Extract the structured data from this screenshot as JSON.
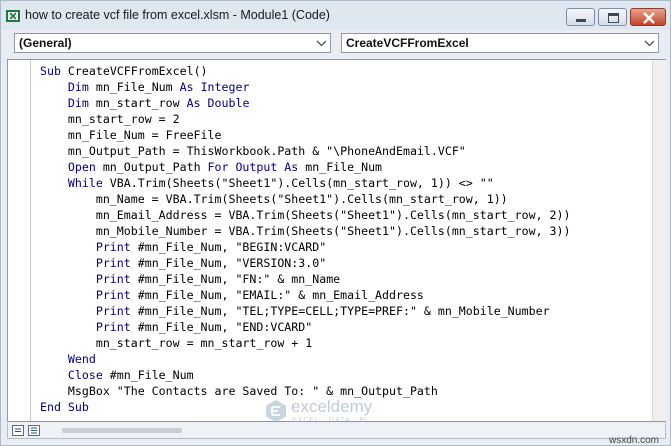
{
  "window": {
    "title": "how to create vcf file from excel.xlsm - Module1 (Code)"
  },
  "toolbar": {
    "object_dropdown": "(General)",
    "procedure_dropdown": "CreateVCFFromExcel"
  },
  "code_lines": [
    {
      "indent": 0,
      "parts": [
        {
          "t": "Sub",
          "k": true
        },
        {
          "t": " CreateVCFFromExcel()"
        }
      ]
    },
    {
      "indent": 1,
      "parts": [
        {
          "t": "Dim",
          "k": true
        },
        {
          "t": " mn_File_Num "
        },
        {
          "t": "As Integer",
          "k": true
        }
      ]
    },
    {
      "indent": 1,
      "parts": [
        {
          "t": "Dim",
          "k": true
        },
        {
          "t": " mn_start_row "
        },
        {
          "t": "As Double",
          "k": true
        }
      ]
    },
    {
      "indent": 1,
      "parts": [
        {
          "t": "mn_start_row = 2"
        }
      ]
    },
    {
      "indent": 1,
      "parts": [
        {
          "t": "mn_File_Num = FreeFile"
        }
      ]
    },
    {
      "indent": 1,
      "parts": [
        {
          "t": "mn_Output_Path = ThisWorkbook.Path & \"\\PhoneAndEmail.VCF\""
        }
      ]
    },
    {
      "indent": 1,
      "parts": [
        {
          "t": "Open",
          "k": true
        },
        {
          "t": " mn_Output_Path "
        },
        {
          "t": "For Output As",
          "k": true
        },
        {
          "t": " mn_File_Num"
        }
      ]
    },
    {
      "indent": 1,
      "parts": [
        {
          "t": "While",
          "k": true
        },
        {
          "t": " VBA.Trim(Sheets(\"Sheet1\").Cells(mn_start_row, 1)) <> \"\""
        }
      ]
    },
    {
      "indent": 2,
      "parts": [
        {
          "t": "mn_Name = VBA.Trim(Sheets(\"Sheet1\").Cells(mn_start_row, 1))"
        }
      ]
    },
    {
      "indent": 2,
      "parts": [
        {
          "t": "mn_Email_Address = VBA.Trim(Sheets(\"Sheet1\").Cells(mn_start_row, 2))"
        }
      ]
    },
    {
      "indent": 2,
      "parts": [
        {
          "t": "mn_Mobile_Number = VBA.Trim(Sheets(\"Sheet1\").Cells(mn_start_row, 3))"
        }
      ]
    },
    {
      "indent": 2,
      "parts": [
        {
          "t": "Print",
          "k": true
        },
        {
          "t": " #mn_File_Num, \"BEGIN:VCARD\""
        }
      ]
    },
    {
      "indent": 2,
      "parts": [
        {
          "t": "Print",
          "k": true
        },
        {
          "t": " #mn_File_Num, \"VERSION:3.0\""
        }
      ]
    },
    {
      "indent": 2,
      "parts": [
        {
          "t": "Print",
          "k": true
        },
        {
          "t": " #mn_File_Num, \"FN:\" & mn_Name"
        }
      ]
    },
    {
      "indent": 2,
      "parts": [
        {
          "t": "Print",
          "k": true
        },
        {
          "t": " #mn_File_Num, \"EMAIL:\" & mn_Email_Address"
        }
      ]
    },
    {
      "indent": 2,
      "parts": [
        {
          "t": "Print",
          "k": true
        },
        {
          "t": " #mn_File_Num, \"TEL;TYPE=CELL;TYPE=PREF:\" & mn_Mobile_Number"
        }
      ]
    },
    {
      "indent": 2,
      "parts": [
        {
          "t": "Print",
          "k": true
        },
        {
          "t": " #mn_File_Num, \"END:VCARD\""
        }
      ]
    },
    {
      "indent": 2,
      "parts": [
        {
          "t": "mn_start_row = mn_start_row + 1"
        }
      ]
    },
    {
      "indent": 1,
      "parts": [
        {
          "t": "Wend",
          "k": true
        }
      ]
    },
    {
      "indent": 1,
      "parts": [
        {
          "t": "Close",
          "k": true
        },
        {
          "t": " #mn_File_Num"
        }
      ]
    },
    {
      "indent": 1,
      "parts": [
        {
          "t": "MsgBox \"The Contacts are Saved To: \" & mn_Output_Path"
        }
      ]
    },
    {
      "indent": 0,
      "parts": [
        {
          "t": "End Sub",
          "k": true
        }
      ]
    }
  ],
  "watermark": {
    "name": "exceldemy",
    "tagline": "EXCEL · DATA · BI"
  },
  "footer": {
    "site": "wsxdn.com"
  },
  "colors": {
    "keyword": "#00007f",
    "text": "#000000",
    "close_button": "#c5432a"
  },
  "icons": [
    "excel-vba-icon",
    "minimize-icon",
    "maximize-icon",
    "close-icon",
    "chevron-down-icon",
    "procedure-view-icon",
    "full-module-view-icon",
    "exceldemy-logo-icon"
  ]
}
